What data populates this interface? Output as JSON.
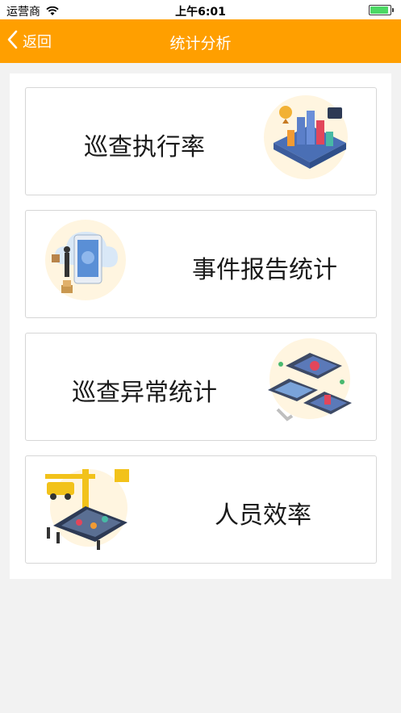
{
  "status_bar": {
    "carrier": "运营商",
    "time": "上午6:01"
  },
  "nav": {
    "back_label": "返回",
    "title": "统计分析"
  },
  "cards": [
    {
      "label": "巡查执行率",
      "illustration": "smart-city-icon"
    },
    {
      "label": "事件报告统计",
      "illustration": "cloud-report-icon"
    },
    {
      "label": "巡查异常统计",
      "illustration": "anomaly-map-icon"
    },
    {
      "label": "人员效率",
      "illustration": "construction-team-icon"
    }
  ],
  "colors": {
    "accent": "#ff9f00",
    "background": "#f2f2f2"
  }
}
